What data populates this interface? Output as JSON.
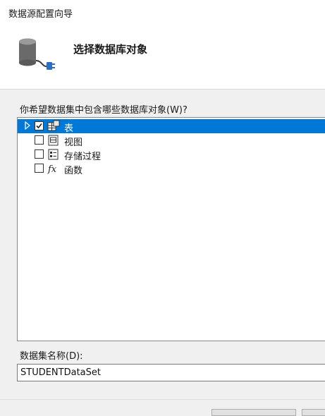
{
  "window": {
    "title": "数据源配置向导"
  },
  "header": {
    "title": "选择数据库对象",
    "icon": "database-plug-icon"
  },
  "objects": {
    "question": "你希望数据集中包含哪些数据库对象(W)?",
    "items": [
      {
        "label": "表",
        "checked": true,
        "selected": true,
        "expandable": true,
        "icon": "table-icon"
      },
      {
        "label": "视图",
        "checked": false,
        "selected": false,
        "expandable": false,
        "icon": "view-icon"
      },
      {
        "label": "存储过程",
        "checked": false,
        "selected": false,
        "expandable": false,
        "icon": "stored-procedure-icon"
      },
      {
        "label": "函数",
        "checked": false,
        "selected": false,
        "expandable": false,
        "icon": "function-icon"
      }
    ]
  },
  "dataset": {
    "label": "数据集名称(D):",
    "value": "STUDENTDataSet"
  },
  "colors": {
    "selection": "#0078d7"
  }
}
